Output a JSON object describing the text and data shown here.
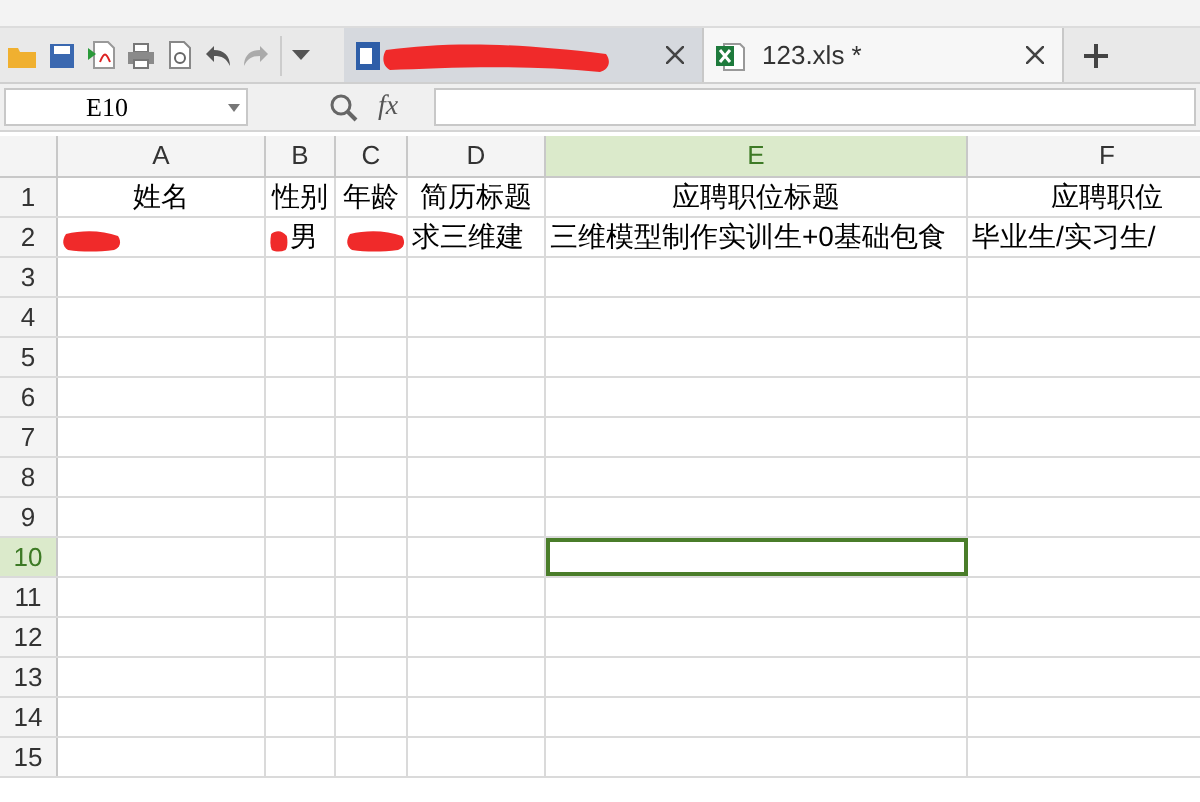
{
  "tabs": [
    {
      "kind": "writer",
      "redacted": true,
      "selected": false
    },
    {
      "kind": "sheet",
      "label": "123.xls *",
      "selected": true
    }
  ],
  "name_box": {
    "value": "E10"
  },
  "formula_bar": {
    "fx": "fx"
  },
  "columns": [
    {
      "label": "A",
      "selected": false
    },
    {
      "label": "B",
      "selected": false
    },
    {
      "label": "C",
      "selected": false
    },
    {
      "label": "D",
      "selected": false
    },
    {
      "label": "E",
      "selected": true
    },
    {
      "label": "F",
      "selected": false
    }
  ],
  "rows": [
    {
      "number": "1",
      "selected": false,
      "cells": [
        {
          "text": "姓名"
        },
        {
          "text": "性别"
        },
        {
          "text": "年龄"
        },
        {
          "text": "简历标题"
        },
        {
          "text": "应聘职位标题"
        },
        {
          "text": "应聘职位"
        }
      ]
    },
    {
      "number": "2",
      "selected": false,
      "cells": [
        {
          "redacted": true
        },
        {
          "text": "男",
          "redacted": true
        },
        {
          "redacted": true
        },
        {
          "text": "求三维建"
        },
        {
          "text": "三维模型制作实训生+0基础包食"
        },
        {
          "text": "毕业生/实习生/"
        }
      ]
    },
    {
      "number": "3",
      "selected": false
    },
    {
      "number": "4",
      "selected": false
    },
    {
      "number": "5",
      "selected": false
    },
    {
      "number": "6",
      "selected": false
    },
    {
      "number": "7",
      "selected": false
    },
    {
      "number": "8",
      "selected": false
    },
    {
      "number": "9",
      "selected": false
    },
    {
      "number": "10",
      "selected": true
    },
    {
      "number": "11",
      "selected": false
    },
    {
      "number": "12",
      "selected": false
    },
    {
      "number": "13",
      "selected": false
    },
    {
      "number": "14",
      "selected": false
    },
    {
      "number": "15",
      "selected": false
    }
  ]
}
